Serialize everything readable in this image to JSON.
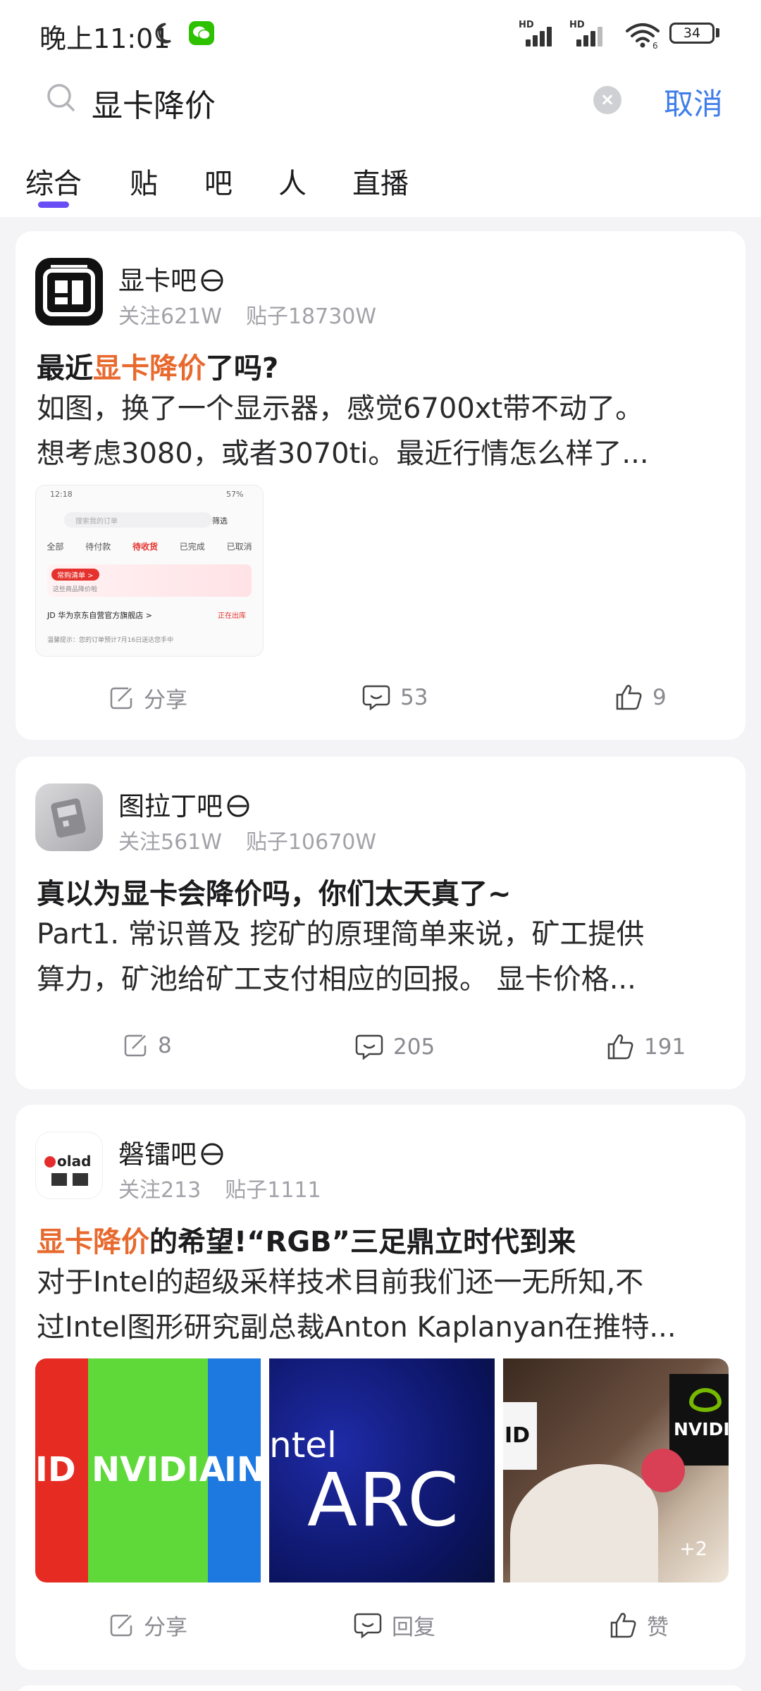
{
  "status_bar": {
    "time": "晚上11:01",
    "network_1": "HD",
    "network_2": "HD",
    "wifi_label": "6",
    "battery": "34"
  },
  "search": {
    "query": "显卡降价",
    "cancel_label": "取消"
  },
  "tabs": [
    {
      "label": "综合",
      "active": true
    },
    {
      "label": "贴"
    },
    {
      "label": "吧"
    },
    {
      "label": "人"
    },
    {
      "label": "直播"
    }
  ],
  "posts": [
    {
      "forum": "显卡吧",
      "followers": "关注621W",
      "post_count": "贴子18730W",
      "title_before": "最近",
      "title_highlight": "显卡降价",
      "title_after": "了吗?",
      "excerpt_lines": [
        "如图，换了一个显示器，感觉6700xt带不动了。",
        "想考虑3080，或者3070ti。最近行情怎么样了..."
      ],
      "thumbnail": {
        "status_time": "12:18",
        "battery": "57%",
        "search_placeholder": "搜索我的订单",
        "filter_label": "筛选",
        "tabs": [
          "全部",
          "待付款",
          "待收货",
          "已完成",
          "已取消"
        ],
        "active_tab": "待收货",
        "promo_pill": "常购清单 >",
        "promo_note": "这些商品降价啦",
        "store": "JD 华为京东自营官方旗舰店 >",
        "store_status": "正在出库",
        "note": "温馨提示：您的订单预计7月16日送达您手中"
      },
      "share_label": "分享",
      "comments": "53",
      "likes": "9"
    },
    {
      "forum": "图拉丁吧",
      "followers": "关注561W",
      "post_count": "贴子10670W",
      "title": "真以为显卡会降价吗，你们太天真了~",
      "excerpt_lines": [
        "Part1. 常识普及 挖矿的原理简单来说，矿工提供",
        "算力，矿池给矿工支付相应的回报。 显卡价格..."
      ],
      "shares": "8",
      "comments": "205",
      "likes": "191"
    },
    {
      "forum": "磐镭吧",
      "followers": "关注213",
      "post_count": "贴子1111",
      "title_highlight": "显卡降价",
      "title_after": "的希望!“RGB”三足鼎立时代到来",
      "excerpt_lines": [
        "对于Intel的超级采样技术目前我们还一无所知,不",
        "过Intel图形研究副总裁Anton Kaplanyan在推特..."
      ],
      "images": {
        "tile1_left": "ID",
        "tile1_mid": "NVIDIA",
        "tile1_right": "IN",
        "tile2_top": "ntel",
        "tile2_main": "ARC",
        "tile3_sign": "ID",
        "tile3_brand": "NVIDIA",
        "more": "+2"
      },
      "share_label": "分享",
      "reply_label": "回复",
      "like_label": "赞"
    }
  ],
  "colors": {
    "highlight": "#e8692e",
    "cancel": "#3f7ee8",
    "tab_indicator": "#6a4ef5"
  }
}
